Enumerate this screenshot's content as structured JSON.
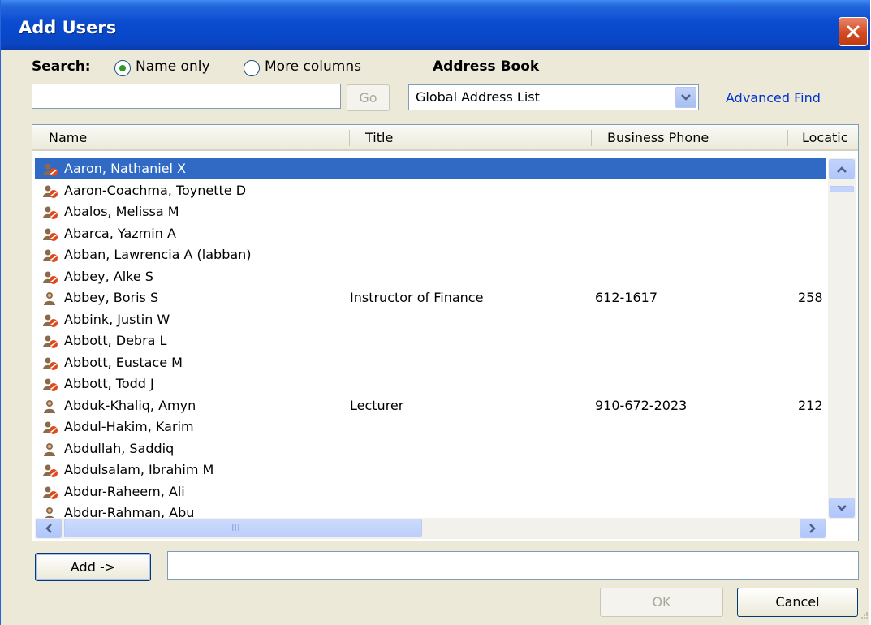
{
  "window": {
    "title": "Add Users"
  },
  "search": {
    "label": "Search:",
    "option_name_only": "Name only",
    "option_more_columns": "More columns",
    "selected_option": "Name only",
    "value": "",
    "go_label": "Go"
  },
  "address_book": {
    "label": "Address Book",
    "selected": "Global Address List",
    "advanced_find": "Advanced Find"
  },
  "columns": [
    "Name",
    "Title",
    "Business Phone",
    "Locatic"
  ],
  "rows": [
    {
      "name": "Aaron, Nathaniel X",
      "title": "",
      "phone": "",
      "location": "",
      "icon": "distribution-contact-icon",
      "selected": true
    },
    {
      "name": "Aaron-Coachma, Toynette D",
      "title": "",
      "phone": "",
      "location": "",
      "icon": "distribution-contact-icon"
    },
    {
      "name": "Abalos, Melissa M",
      "title": "",
      "phone": "",
      "location": "",
      "icon": "distribution-contact-icon"
    },
    {
      "name": "Abarca, Yazmin A",
      "title": "",
      "phone": "",
      "location": "",
      "icon": "distribution-contact-icon"
    },
    {
      "name": "Abban, Lawrencia A (labban)",
      "title": "",
      "phone": "",
      "location": "",
      "icon": "distribution-contact-icon"
    },
    {
      "name": "Abbey, Alke S",
      "title": "",
      "phone": "",
      "location": "",
      "icon": "distribution-contact-icon"
    },
    {
      "name": "Abbey, Boris S",
      "title": "Instructor of Finance",
      "phone": "612-1617",
      "location": "258",
      "icon": "user-icon"
    },
    {
      "name": "Abbink, Justin W",
      "title": "",
      "phone": "",
      "location": "",
      "icon": "distribution-contact-icon"
    },
    {
      "name": "Abbott, Debra L",
      "title": "",
      "phone": "",
      "location": "",
      "icon": "distribution-contact-icon"
    },
    {
      "name": "Abbott, Eustace M",
      "title": "",
      "phone": "",
      "location": "",
      "icon": "distribution-contact-icon"
    },
    {
      "name": "Abbott, Todd J",
      "title": "",
      "phone": "",
      "location": "",
      "icon": "distribution-contact-icon"
    },
    {
      "name": "Abduk-Khaliq, Amyn",
      "title": "Lecturer",
      "phone": "910-672-2023",
      "location": "212",
      "icon": "user-icon"
    },
    {
      "name": "Abdul-Hakim, Karim",
      "title": "",
      "phone": "",
      "location": "",
      "icon": "distribution-contact-icon"
    },
    {
      "name": "Abdullah, Saddiq",
      "title": "",
      "phone": "",
      "location": "",
      "icon": "user-icon"
    },
    {
      "name": "Abdulsalam, Ibrahim M",
      "title": "",
      "phone": "",
      "location": "",
      "icon": "distribution-contact-icon"
    },
    {
      "name": "Abdur-Raheem, Ali",
      "title": "",
      "phone": "",
      "location": "",
      "icon": "distribution-contact-icon"
    },
    {
      "name": "Abdur-Rahman, Abu",
      "title": "",
      "phone": "",
      "location": "",
      "icon": "user-icon"
    }
  ],
  "scrollbar_h_grip": "III",
  "footer": {
    "add_label": "Add ->",
    "recipients_value": "",
    "ok_label": "OK",
    "cancel_label": "Cancel"
  },
  "colors": {
    "titlebar": "#0a4bd0",
    "dialog_bg": "#ece9d8",
    "selection": "#316ac5",
    "link": "#0033cc",
    "close_button": "#d24a22"
  }
}
